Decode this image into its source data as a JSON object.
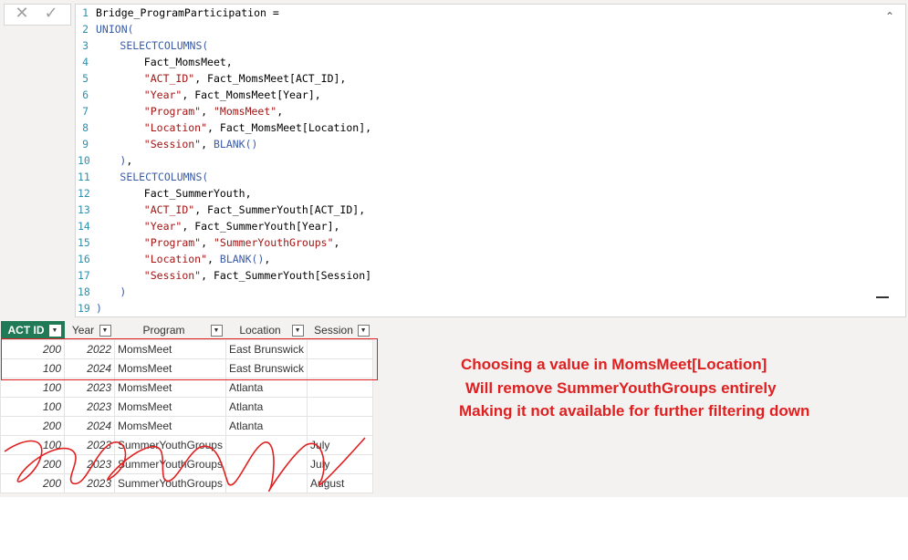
{
  "commit_bar": {
    "cancel_glyph": "✕",
    "commit_glyph": "✓"
  },
  "editor": {
    "lines": [
      {
        "n": "1",
        "indent": 0,
        "tokens": [
          [
            "p",
            "Bridge_ProgramParticipation ="
          ]
        ]
      },
      {
        "n": "2",
        "indent": 0,
        "tokens": [
          [
            "f",
            "UNION("
          ]
        ]
      },
      {
        "n": "3",
        "indent": 4,
        "tokens": [
          [
            "f",
            "SELECTCOLUMNS("
          ]
        ]
      },
      {
        "n": "4",
        "indent": 8,
        "tokens": [
          [
            "p",
            "Fact_MomsMeet,"
          ]
        ]
      },
      {
        "n": "5",
        "indent": 8,
        "tokens": [
          [
            "s",
            "\"ACT_ID\""
          ],
          [
            "p",
            ", Fact_MomsMeet[ACT_ID],"
          ]
        ]
      },
      {
        "n": "6",
        "indent": 8,
        "tokens": [
          [
            "s",
            "\"Year\""
          ],
          [
            "p",
            ", Fact_MomsMeet[Year],"
          ]
        ]
      },
      {
        "n": "7",
        "indent": 8,
        "tokens": [
          [
            "s",
            "\"Program\""
          ],
          [
            "p",
            ", "
          ],
          [
            "s",
            "\"MomsMeet\""
          ],
          [
            "p",
            ","
          ]
        ]
      },
      {
        "n": "8",
        "indent": 8,
        "tokens": [
          [
            "s",
            "\"Location\""
          ],
          [
            "p",
            ", Fact_MomsMeet[Location],"
          ]
        ]
      },
      {
        "n": "9",
        "indent": 8,
        "tokens": [
          [
            "s",
            "\"Session\""
          ],
          [
            "p",
            ", "
          ],
          [
            "f",
            "BLANK()"
          ]
        ]
      },
      {
        "n": "10",
        "indent": 4,
        "tokens": [
          [
            "f",
            ")"
          ],
          [
            "p",
            ","
          ]
        ]
      },
      {
        "n": "11",
        "indent": 4,
        "tokens": [
          [
            "f",
            "SELECTCOLUMNS("
          ]
        ]
      },
      {
        "n": "12",
        "indent": 8,
        "tokens": [
          [
            "p",
            "Fact_SummerYouth,"
          ]
        ]
      },
      {
        "n": "13",
        "indent": 8,
        "tokens": [
          [
            "s",
            "\"ACT_ID\""
          ],
          [
            "p",
            ", Fact_SummerYouth[ACT_ID],"
          ]
        ]
      },
      {
        "n": "14",
        "indent": 8,
        "tokens": [
          [
            "s",
            "\"Year\""
          ],
          [
            "p",
            ", Fact_SummerYouth[Year],"
          ]
        ]
      },
      {
        "n": "15",
        "indent": 8,
        "tokens": [
          [
            "s",
            "\"Program\""
          ],
          [
            "p",
            ", "
          ],
          [
            "s",
            "\"SummerYouthGroups\""
          ],
          [
            "p",
            ","
          ]
        ]
      },
      {
        "n": "16",
        "indent": 8,
        "tokens": [
          [
            "s",
            "\"Location\""
          ],
          [
            "p",
            ", "
          ],
          [
            "f",
            "BLANK()"
          ],
          [
            "p",
            ","
          ]
        ]
      },
      {
        "n": "17",
        "indent": 8,
        "tokens": [
          [
            "s",
            "\"Session\""
          ],
          [
            "p",
            ", Fact_SummerYouth[Session]"
          ]
        ]
      },
      {
        "n": "18",
        "indent": 4,
        "tokens": [
          [
            "f",
            ")"
          ]
        ]
      },
      {
        "n": "19",
        "indent": 0,
        "tokens": [
          [
            "f",
            ")"
          ]
        ]
      }
    ]
  },
  "grid": {
    "columns": [
      "ACT ID",
      "Year",
      "Program",
      "Location",
      "Session"
    ],
    "rows": [
      [
        "200",
        "2022",
        "MomsMeet",
        "East Brunswick",
        ""
      ],
      [
        "100",
        "2024",
        "MomsMeet",
        "East Brunswick",
        ""
      ],
      [
        "100",
        "2023",
        "MomsMeet",
        "Atlanta",
        ""
      ],
      [
        "100",
        "2023",
        "MomsMeet",
        "Atlanta",
        ""
      ],
      [
        "200",
        "2024",
        "MomsMeet",
        "Atlanta",
        ""
      ],
      [
        "100",
        "2023",
        "SummerYouthGroups",
        "",
        "July"
      ],
      [
        "200",
        "2023",
        "SummerYouthGroups",
        "",
        "July"
      ],
      [
        "200",
        "2023",
        "SummerYouthGroups",
        "",
        "August"
      ]
    ]
  },
  "annotation": {
    "line1": "Choosing a value in MomsMeet[Location]",
    "line2": "Will remove SummerYouthGroups entirely",
    "line3": "Making it not available for further filtering down"
  },
  "colors": {
    "accent_header": "#1f7a55",
    "annotation": "#e02020",
    "function": "#3a5ba8",
    "string": "#a31515",
    "line_number": "#2b91af"
  }
}
